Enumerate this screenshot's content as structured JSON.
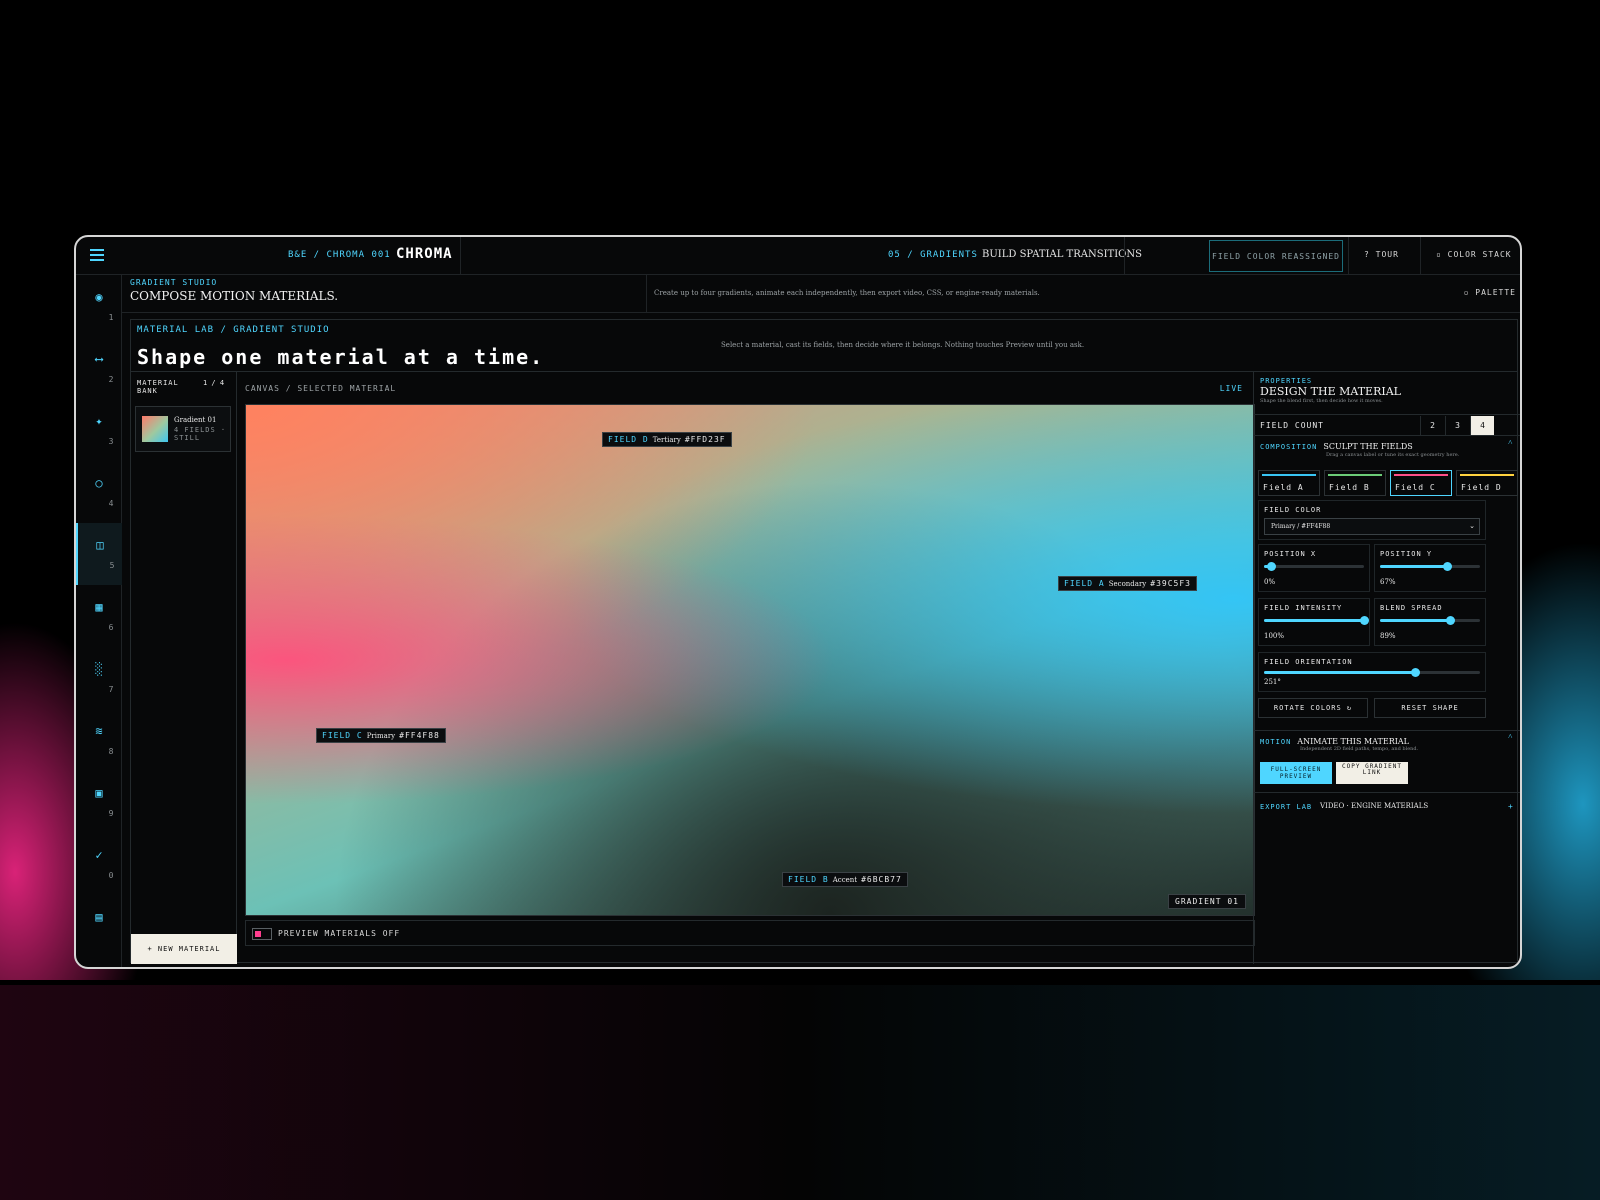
{
  "topbar": {
    "crumb": "B&E / CHROMA 001",
    "brand": "CHROMA",
    "section_crumb": "05 / GRADIENTS",
    "section_title": "BUILD SPATIAL TRANSITIONS",
    "status_badge": "FIELD COLOR REASSIGNED",
    "tour": "? TOUR",
    "color_stack": "▫ COLOR STACK"
  },
  "rail": {
    "items": [
      {
        "icon": "◉",
        "num": "1"
      },
      {
        "icon": "⟷",
        "num": "2"
      },
      {
        "icon": "✦",
        "num": "3"
      },
      {
        "icon": "○",
        "num": "4"
      },
      {
        "icon": "◫",
        "num": "5"
      },
      {
        "icon": "▦",
        "num": "6"
      },
      {
        "icon": "░",
        "num": "7"
      },
      {
        "icon": "≋",
        "num": "8"
      },
      {
        "icon": "▣",
        "num": "9"
      },
      {
        "icon": "✓",
        "num": "0"
      },
      {
        "icon": "▤",
        "num": ""
      }
    ]
  },
  "studio": {
    "kicker": "GRADIENT STUDIO",
    "title": "COMPOSE MOTION MATERIALS.",
    "description": "Create up to four gradients, animate each independently, then export video, CSS, or engine-ready materials.",
    "palette": "▫ PALETTE"
  },
  "lab": {
    "kicker": "MATERIAL LAB / GRADIENT STUDIO",
    "title": "Shape one material at a time.",
    "description": "Select a material, cast its fields, then decide where it belongs. Nothing touches Preview until you ask."
  },
  "bank": {
    "label": "MATERIAL BANK",
    "count": "1 / 4",
    "card": {
      "name": "Gradient 01",
      "meta": "4 FIELDS · STILL"
    },
    "new_button": "+ NEW MATERIAL"
  },
  "canvas": {
    "label": "CANVAS / SELECTED MATERIAL",
    "live": "LIVE",
    "fields": [
      {
        "name": "FIELD D",
        "role": "Tertiary",
        "hex": "#FFD23F"
      },
      {
        "name": "FIELD A",
        "role": "Secondary",
        "hex": "#39C5F3"
      },
      {
        "name": "FIELD C",
        "role": "Primary",
        "hex": "#FF4F88"
      },
      {
        "name": "FIELD B",
        "role": "Accent",
        "hex": "#6BCB77"
      }
    ],
    "gradient_badge": "GRADIENT 01",
    "preview_label": "PREVIEW MATERIALS OFF"
  },
  "props": {
    "kicker": "PROPERTIES",
    "title": "DESIGN THE MATERIAL",
    "subtitle": "Shape the blend first, then decide how it moves.",
    "field_count_label": "FIELD COUNT",
    "field_count_options": [
      "2",
      "3",
      "4"
    ],
    "composition_kicker": "COMPOSITION",
    "composition_title": "SCULPT THE FIELDS",
    "composition_sub": "Drag a canvas label or tune its exact geometry here.",
    "field_tabs": [
      {
        "label": "Field A",
        "color": "#39C5F3"
      },
      {
        "label": "Field B",
        "color": "#6BCB77"
      },
      {
        "label": "Field C",
        "color": "#FF4F88"
      },
      {
        "label": "Field D",
        "color": "#FFD23F"
      }
    ],
    "field_color_label": "FIELD COLOR",
    "field_color_value": "Primary / #FF4F88",
    "position_x": {
      "label": "POSITION X",
      "value": "0%",
      "level": 0.07
    },
    "position_y": {
      "label": "POSITION Y",
      "value": "67%",
      "level": 0.67
    },
    "intensity": {
      "label": "FIELD INTENSITY",
      "value": "100%",
      "level": 1.0
    },
    "blend": {
      "label": "BLEND SPREAD",
      "value": "89%",
      "level": 0.7
    },
    "orientation": {
      "label": "FIELD ORIENTATION",
      "value": "251°",
      "level": 0.7
    },
    "rotate_button": "ROTATE COLORS ↻",
    "reset_button": "RESET SHAPE",
    "motion_kicker": "MOTION",
    "motion_title": "ANIMATE THIS MATERIAL",
    "motion_sub": "Independent 2D field paths, tempo, and blend.",
    "fullscreen_button": "FULL-SCREEN PREVIEW",
    "copy_button": "COPY GRADIENT LINK",
    "export_kicker": "EXPORT LAB",
    "export_value": "VIDEO · ENGINE MATERIALS"
  },
  "colors": {
    "accent": "#4FD6FF",
    "active_fill": "#F2EFE6",
    "preview_toggle": "#FF3D8E"
  }
}
